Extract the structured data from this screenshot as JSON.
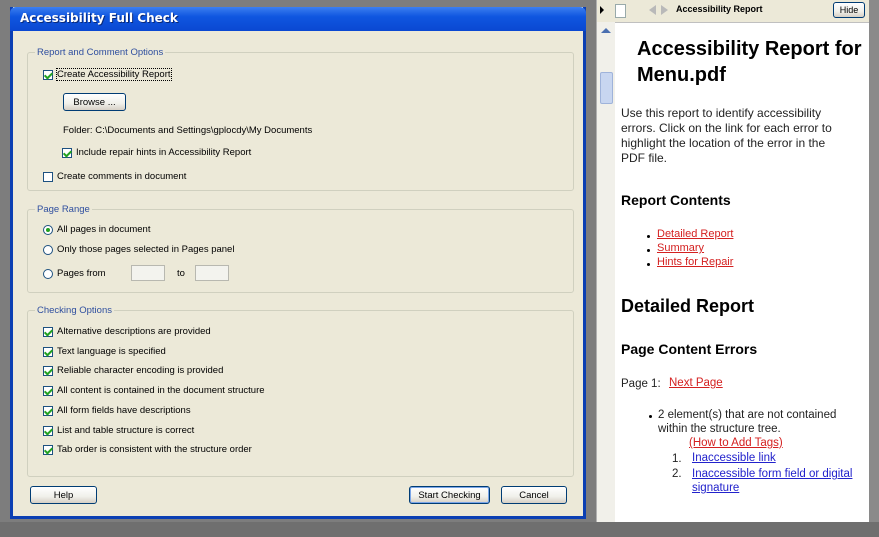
{
  "dialog": {
    "title": "Accessibility Full Check",
    "report_group": {
      "label": "Report and Comment Options",
      "create_report": "Create Accessibility Report",
      "browse_button": "Browse ...",
      "folder_label": "Folder: C:\\Documents and Settings\\gplocdy\\My Documents",
      "include_hints": "Include repair hints in Accessibility Report",
      "create_comments": "Create comments in document"
    },
    "page_range": {
      "label": "Page Range",
      "all_pages": "All pages in document",
      "selected_pages": "Only those pages selected in Pages panel",
      "pages_from": "Pages from",
      "to_label": "to"
    },
    "checking_options": {
      "label": "Checking Options",
      "items": [
        "Alternative descriptions are provided",
        "Text language is specified",
        "Reliable character encoding is provided",
        "All content is contained in the document structure",
        "All form fields have descriptions",
        "List and table structure is correct",
        "Tab order is consistent with the structure order"
      ]
    },
    "help_button": "Help",
    "start_button": "Start Checking",
    "cancel_button": "Cancel"
  },
  "panel": {
    "toolbar_title": "Accessibility Report",
    "hide_button": "Hide",
    "title": "Accessibility Report for Menu.pdf",
    "intro": "Use this report to identify accessibility errors. Click on the link for each error to highlight the location of the error in the PDF file.",
    "contents_heading": "Report Contents",
    "contents_links": [
      "Detailed Report",
      "Summary",
      "Hints for Repair"
    ],
    "detailed_heading": "Detailed Report",
    "page_errors_heading": "Page Content Errors",
    "page_label": "Page 1:",
    "next_page": "Next Page",
    "error_text": "2 element(s) that are not contained within the structure tree.",
    "how_to_link": "(How to Add Tags)",
    "sub_items": [
      "Inaccessible link",
      "Inaccessible form field or digital signature"
    ]
  },
  "colors": {
    "titlebar": "#0f56e0",
    "dialog_bg": "#ece9d8",
    "link_red": "#d42020",
    "link_blue": "#2222cc"
  }
}
